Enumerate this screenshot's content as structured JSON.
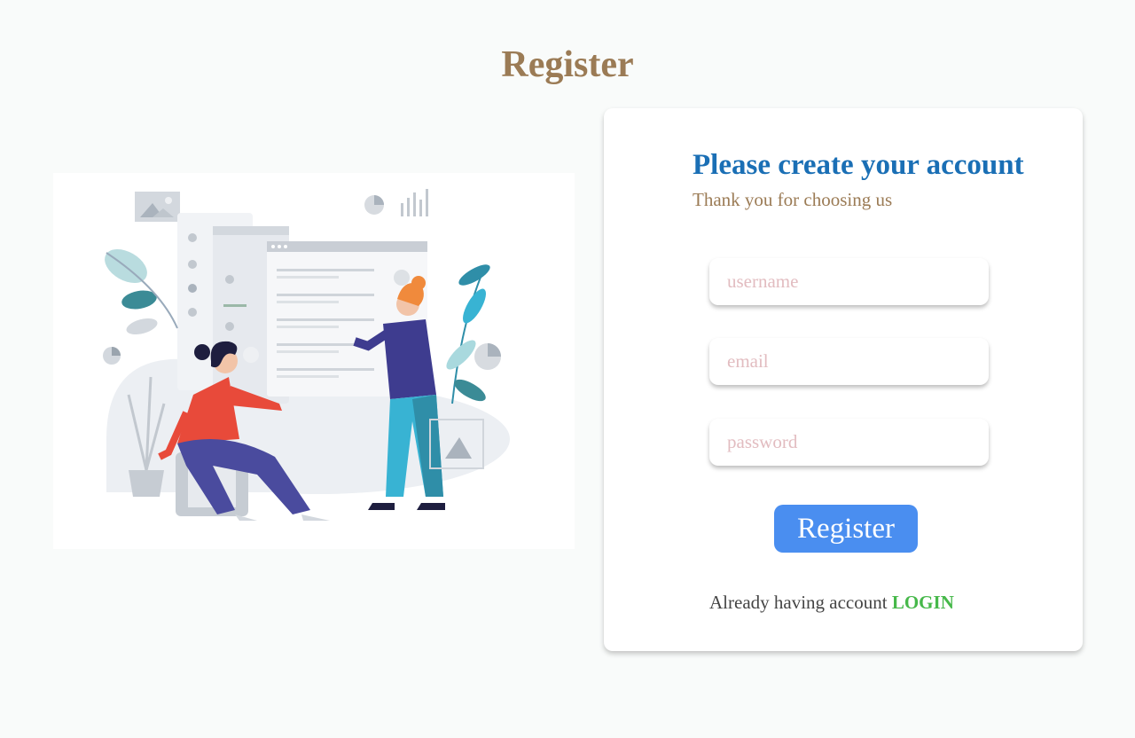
{
  "header": {
    "title": "Register"
  },
  "illustration": {
    "icon": "team-collaboration-illustration"
  },
  "form": {
    "heading": "Please create your account",
    "subheading": "Thank you for choosing us",
    "username_placeholder": "username",
    "email_placeholder": "email",
    "password_placeholder": "password",
    "submit_label": "Register"
  },
  "footer": {
    "prompt": "Already having account",
    "login_label": "LOGIN"
  },
  "colors": {
    "title": "#9b7b55",
    "heading": "#1a6fb5",
    "button": "#4a8ef0",
    "link": "#46b84a",
    "placeholder": "#e2bcc0"
  }
}
